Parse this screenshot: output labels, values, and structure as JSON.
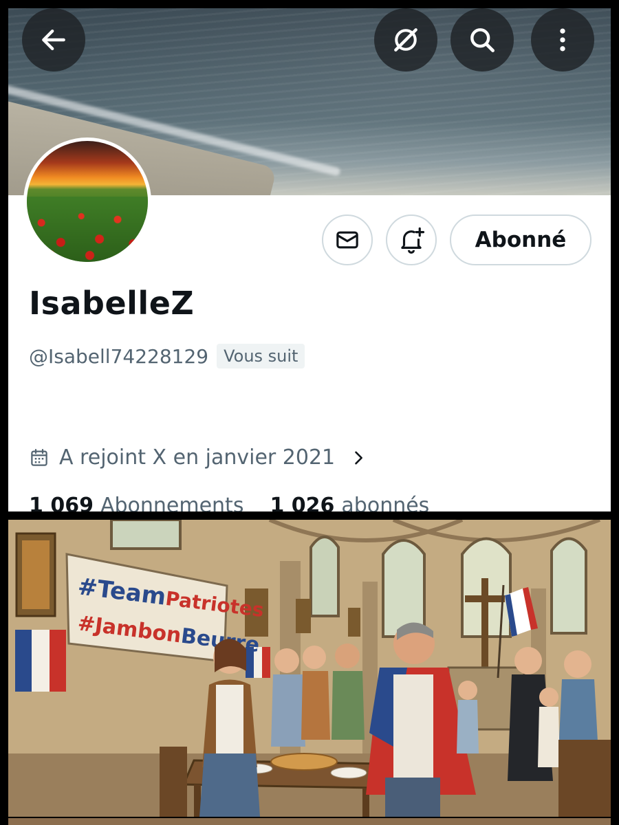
{
  "profile": {
    "display_name": "IsabelleZ",
    "handle": "@Isabell74228129",
    "follows_you_badge": "Vous suit",
    "joined": "A rejoint X en janvier 2021",
    "following_count": "1 069",
    "following_label": "Abonnements",
    "followers_count": "1 026",
    "followers_label": "abonnés"
  },
  "actions": {
    "follow_label": "Abonné",
    "message_icon": "envelope-icon",
    "notify_icon": "bell-plus-icon"
  },
  "header_icons": [
    "back-arrow-icon",
    "grok-icon",
    "search-icon",
    "more-vertical-icon"
  ],
  "illustration": {
    "banner_line1_part1": "#Team",
    "banner_line1_part2": "Patriotes",
    "banner_line2_part1": "#Jambon",
    "banner_line2_part2": "Beurre"
  },
  "colors": {
    "text_primary": "#0f1419",
    "text_secondary": "#536471",
    "border": "#cfd9de",
    "flag_blue": "#2a4a8c",
    "flag_red": "#c8322a"
  }
}
